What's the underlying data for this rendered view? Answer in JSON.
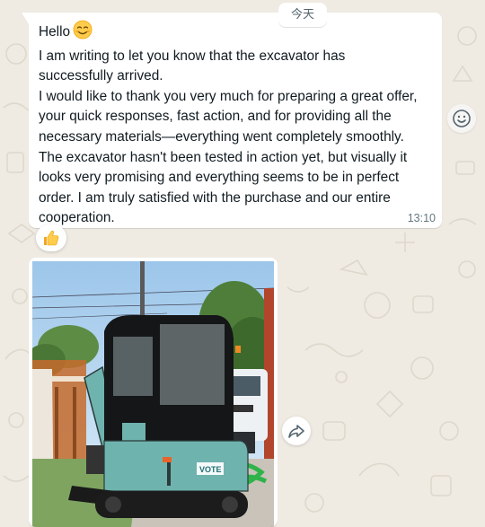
{
  "chat": {
    "date_chip": "今天",
    "message": {
      "lines": [
        "Hello",
        "I am writing to let you know that the excavator has",
        "successfully arrived.",
        "I would like to thank you very much for preparing a great offer,",
        "your quick responses, fast action, and for providing all the",
        "necessary materials—everything went completely smoothly.",
        "The excavator hasn't been tested in action yet, but visually it",
        "looks very promising and everything seems to be in perfect",
        "order. I am truly satisfied with the purchase and our entire",
        "cooperation."
      ],
      "greeting_emoji": "smiling-face-emoji",
      "time": "13:10",
      "reaction": "thumbs-up-emoji"
    },
    "image_message": {
      "machine_brand": "VOTE",
      "forward_icon": "forward-icon"
    },
    "colors": {
      "wallpaper": "#efeae2",
      "bubble": "#ffffff",
      "text": "#111b21",
      "meta_text": "#667781",
      "machine_teal": "#6fb3ae"
    }
  }
}
